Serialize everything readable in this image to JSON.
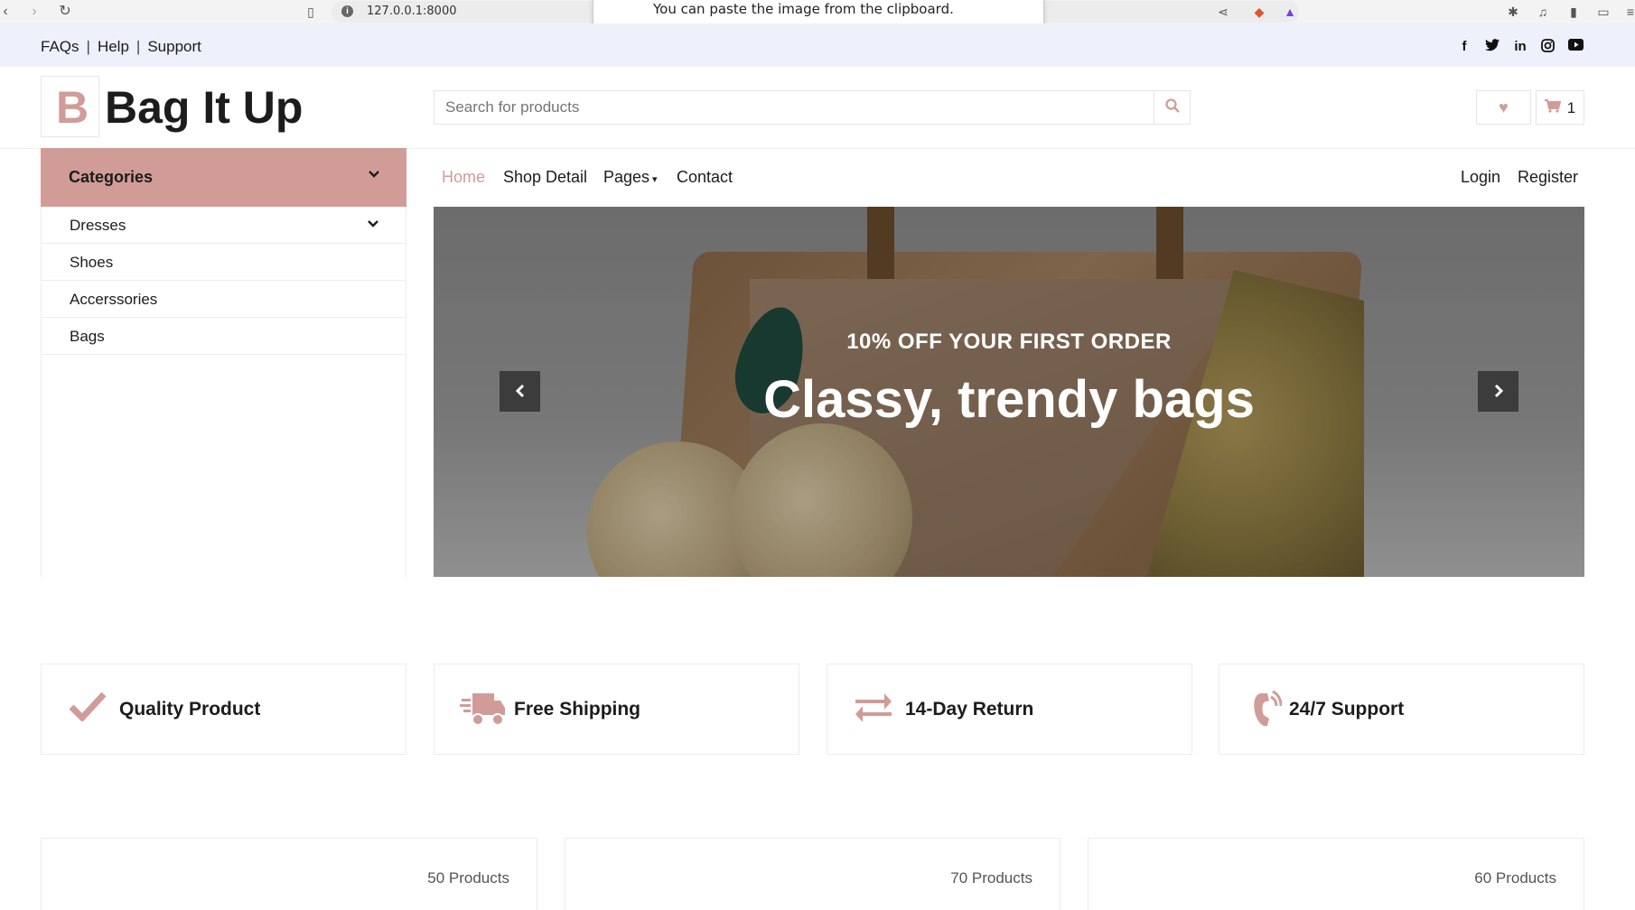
{
  "browser": {
    "url": "127.0.0.1:8000",
    "clipboard_notice": "You can paste the image from the clipboard."
  },
  "topbar": {
    "links": [
      "FAQs",
      "Help",
      "Support"
    ],
    "separator": "|",
    "social": [
      "facebook-icon",
      "twitter-icon",
      "linkedin-icon",
      "instagram-icon",
      "youtube-icon"
    ]
  },
  "header": {
    "logo_letter": "B",
    "logo_text": "Bag It Up",
    "search_placeholder": "Search for products",
    "cart_count": "1"
  },
  "categories": {
    "title": "Categories",
    "items": [
      {
        "label": "Dresses",
        "has_submenu": true
      },
      {
        "label": "Shoes",
        "has_submenu": false
      },
      {
        "label": "Accerssories",
        "has_submenu": false
      },
      {
        "label": "Bags",
        "has_submenu": false
      }
    ]
  },
  "nav": {
    "items": [
      "Home",
      "Shop Detail",
      "Pages",
      "Contact"
    ],
    "active": "Home",
    "auth": [
      "Login",
      "Register"
    ]
  },
  "hero": {
    "subtitle": "10% OFF YOUR FIRST ORDER",
    "title": "Classy, trendy bags"
  },
  "features": [
    {
      "icon": "check-icon",
      "label": "Quality Product"
    },
    {
      "icon": "truck-icon",
      "label": "Free Shipping"
    },
    {
      "icon": "exchange-icon",
      "label": "14-Day Return"
    },
    {
      "icon": "phone-volume-icon",
      "label": "24/7 Support"
    }
  ],
  "product_categories": [
    {
      "count": "50 Products"
    },
    {
      "count": "70 Products"
    },
    {
      "count": "60 Products"
    }
  ],
  "colors": {
    "accent": "#d19c97",
    "topbar_bg": "#eef0fb",
    "text_dark": "#1c1c1c"
  }
}
